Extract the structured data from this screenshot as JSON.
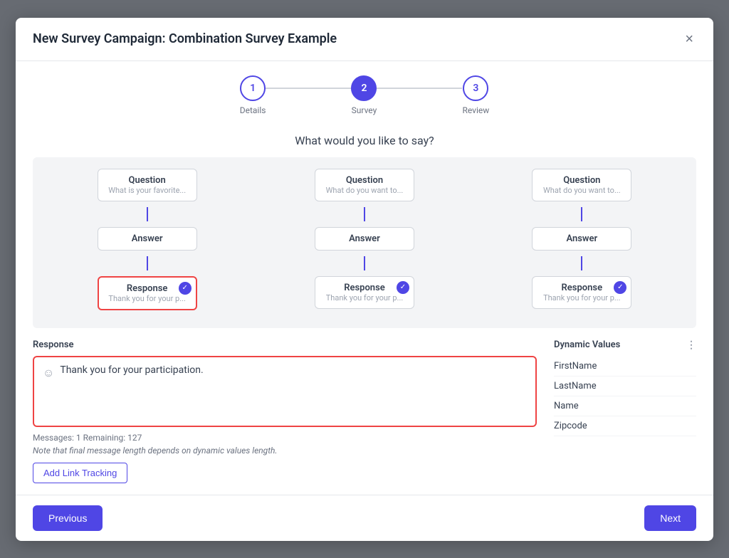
{
  "modal": {
    "title": "New Survey Campaign: Combination Survey Example",
    "close_label": "×"
  },
  "stepper": {
    "steps": [
      {
        "number": "1",
        "label": "Details",
        "active": false
      },
      {
        "number": "2",
        "label": "Survey",
        "active": true
      },
      {
        "number": "3",
        "label": "Review",
        "active": false
      }
    ]
  },
  "section_title": "What would you like to say?",
  "flow": {
    "columns": [
      {
        "question_title": "Question",
        "question_sub": "What is your favorite...",
        "answer_title": "Answer",
        "response_title": "Response",
        "response_sub": "Thank you for your p...",
        "selected": true
      },
      {
        "question_title": "Question",
        "question_sub": "What do you want to...",
        "answer_title": "Answer",
        "response_title": "Response",
        "response_sub": "Thank you for your p...",
        "selected": false
      },
      {
        "question_title": "Question",
        "question_sub": "What do you want to...",
        "answer_title": "Answer",
        "response_title": "Response",
        "response_sub": "Thank you for your p...",
        "selected": false
      }
    ]
  },
  "response_section": {
    "label": "Response",
    "icon": "☺",
    "text": "Thank you for your participation."
  },
  "dynamic_values": {
    "label": "Dynamic Values",
    "items": [
      "FirstName",
      "LastName",
      "Name",
      "Zipcode"
    ]
  },
  "messages_info": "Messages: 1 Remaining: 127",
  "messages_note": "Note that final message length depends on dynamic values length.",
  "link_tracking_btn": "Add Link Tracking",
  "footer": {
    "previous_label": "Previous",
    "next_label": "Next"
  }
}
